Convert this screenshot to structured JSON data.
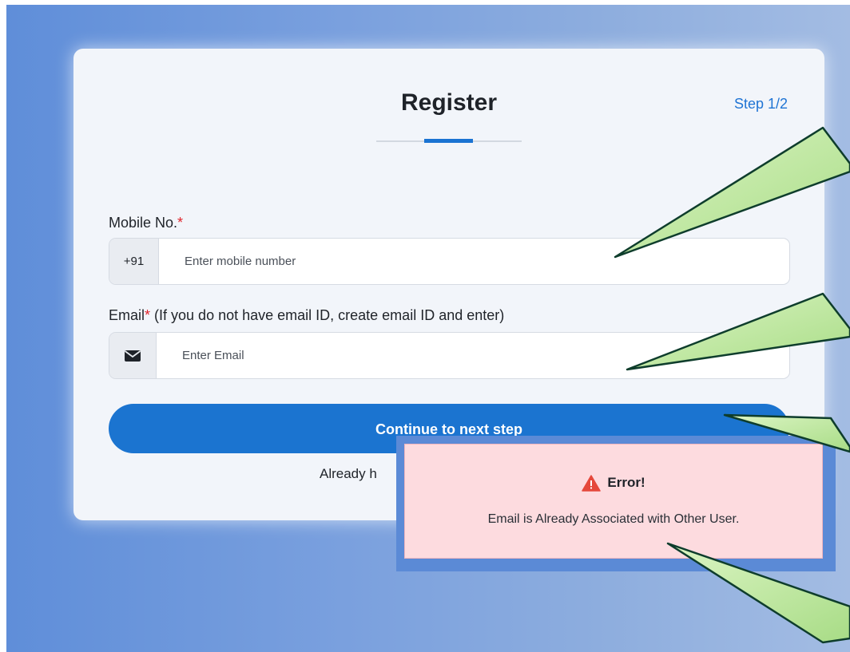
{
  "form": {
    "title": "Register",
    "step": "Step 1/2",
    "mobile": {
      "label": "Mobile No.",
      "required_mark": "*",
      "prefix": "+91",
      "placeholder": "Enter mobile number",
      "value": ""
    },
    "email": {
      "label": "Email",
      "required_mark": "*",
      "hint": " (If you do not have email ID, create email ID and enter)",
      "placeholder": "Enter Email",
      "value": "",
      "icon": "envelope-icon"
    },
    "continue_label": "Continue to next step",
    "already_text": "Already h"
  },
  "toast": {
    "title": "Error!",
    "message": "Email is Already Associated with Other User.",
    "icon": "warning-icon",
    "icon_color": "#e5483b"
  },
  "colors": {
    "primary": "#1b74d0",
    "callout_fill": "#bfe8a0",
    "error_bg": "#fddbdf"
  }
}
